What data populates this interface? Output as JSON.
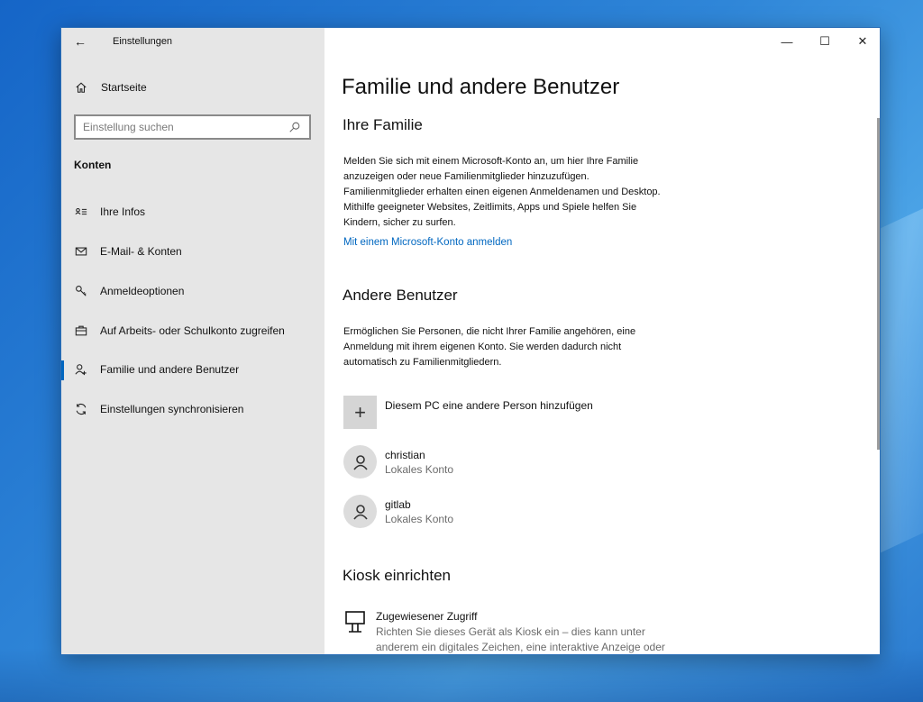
{
  "window": {
    "title": "Einstellungen",
    "back_glyph": "←",
    "controls": {
      "minimize": "—",
      "maximize": "☐",
      "close": "✕"
    }
  },
  "sidebar": {
    "home_label": "Startseite",
    "search_placeholder": "Einstellung suchen",
    "section_title": "Konten",
    "items": [
      {
        "label": "Ihre Infos",
        "icon": "contact-card-icon"
      },
      {
        "label": "E-Mail- & Konten",
        "icon": "mail-icon"
      },
      {
        "label": "Anmeldeoptionen",
        "icon": "key-icon"
      },
      {
        "label": "Auf Arbeits- oder Schulkonto zugreifen",
        "icon": "briefcase-icon"
      },
      {
        "label": "Familie und andere Benutzer",
        "icon": "person-add-icon",
        "active": true
      },
      {
        "label": "Einstellungen synchronisieren",
        "icon": "sync-icon"
      }
    ]
  },
  "main": {
    "title": "Familie und andere Benutzer",
    "family": {
      "heading": "Ihre Familie",
      "text_lines": [
        "Melden Sie sich mit einem Microsoft-Konto an, um hier Ihre Familie",
        "anzuzeigen oder neue Familienmitglieder hinzuzufügen.",
        "Familienmitglieder erhalten einen eigenen Anmeldenamen und Desktop.",
        "Mithilfe geeigneter Websites, Zeitlimits, Apps und Spiele helfen Sie",
        "Kindern, sicher zu surfen."
      ],
      "link": "Mit einem Microsoft-Konto anmelden"
    },
    "others": {
      "heading": "Andere Benutzer",
      "text_lines": [
        "Ermöglichen Sie Personen, die nicht Ihrer Familie angehören, eine",
        "Anmeldung mit ihrem eigenen Konto. Sie werden dadurch nicht",
        "automatisch zu Familienmitgliedern."
      ],
      "add_label": "Diesem PC eine andere Person hinzufügen",
      "add_glyph": "+",
      "users": [
        {
          "name": "christian",
          "type": "Lokales Konto"
        },
        {
          "name": "gitlab",
          "type": "Lokales Konto"
        }
      ]
    },
    "kiosk": {
      "heading": "Kiosk einrichten",
      "item_title": "Zugewiesener Zugriff",
      "item_desc_lines": [
        "Richten Sie dieses Gerät als Kiosk ein – dies kann unter",
        "anderem ein digitales Zeichen, eine interaktive Anzeige oder"
      ]
    }
  },
  "colors": {
    "accent": "#0067c0",
    "sidebar_bg": "#e6e6e6"
  }
}
